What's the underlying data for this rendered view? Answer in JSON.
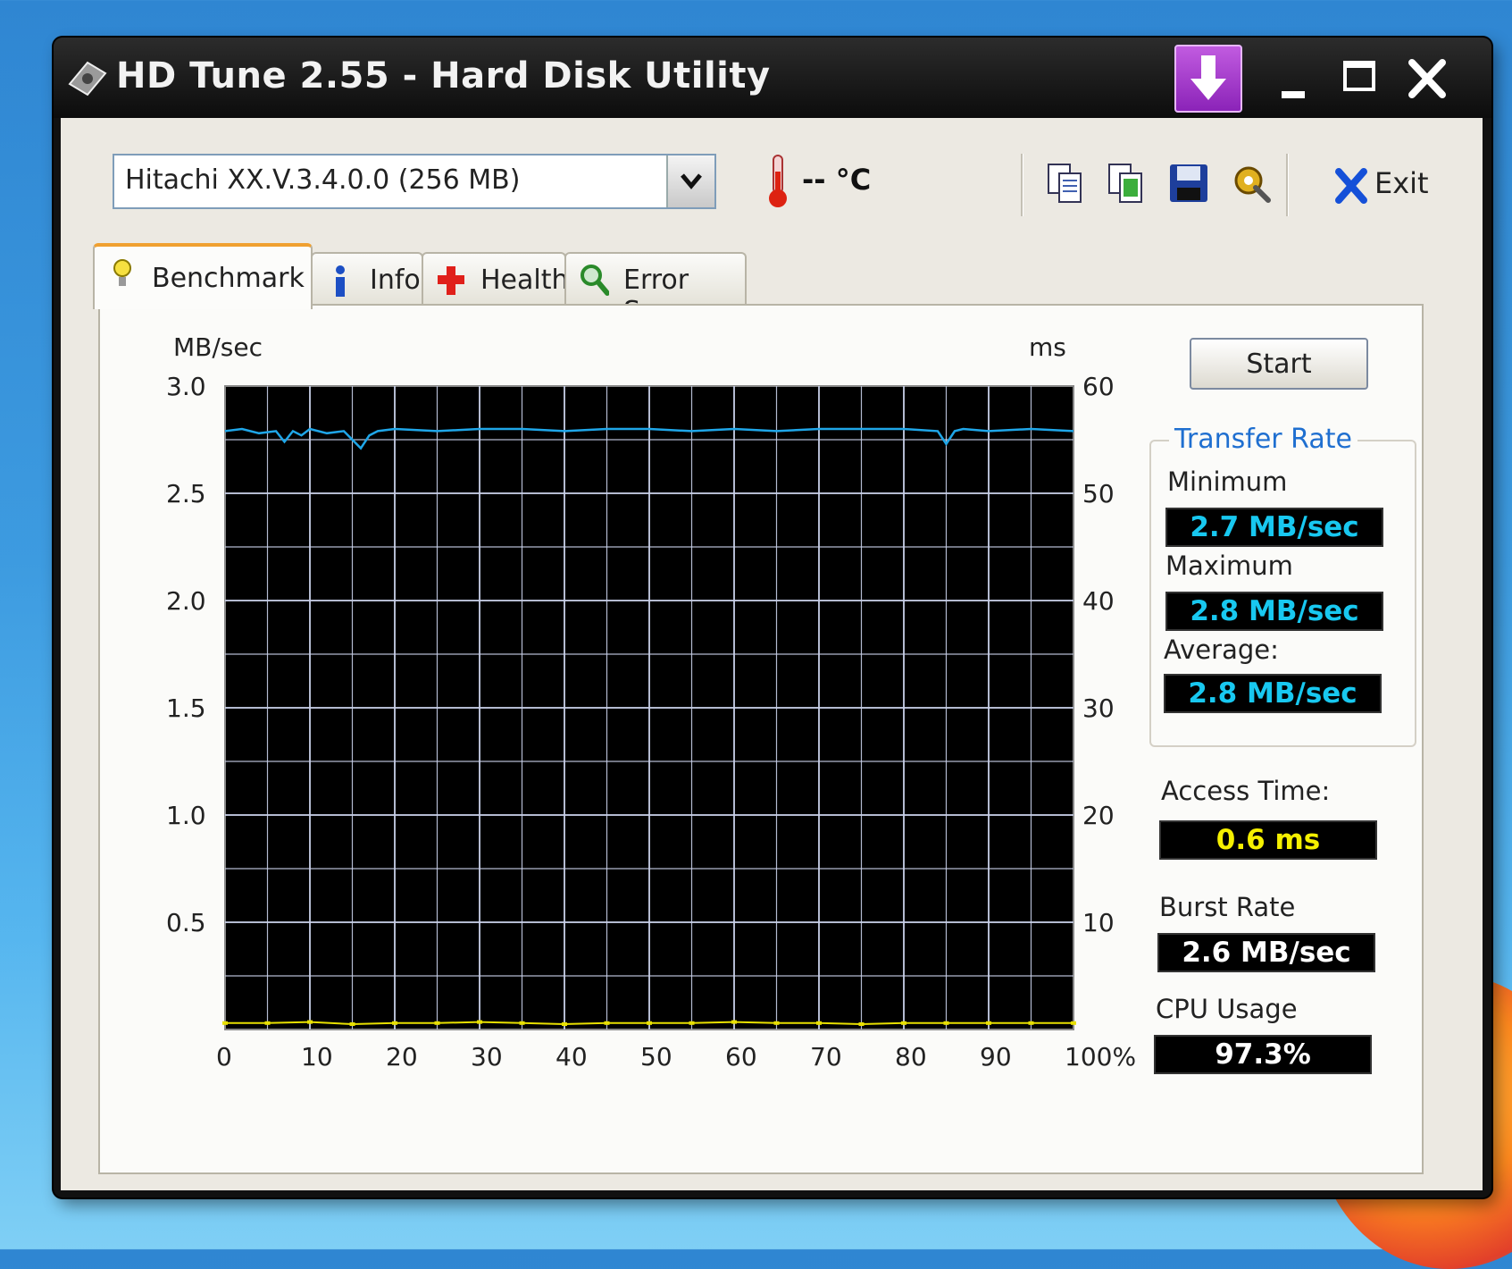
{
  "window": {
    "title": "HD Tune 2.55 - Hard Disk Utility"
  },
  "toolbar": {
    "drive_select_value": "Hitachi XX.V.3.4.0.0 (256 MB)",
    "temperature": "-- °C",
    "exit_label": "Exit",
    "icons": [
      "copy-text-icon",
      "copy-screenshot-icon",
      "save-icon",
      "options-icon"
    ]
  },
  "tabs": [
    {
      "label": "Benchmark",
      "icon": "bulb-icon",
      "active": true
    },
    {
      "label": "Info",
      "icon": "info-icon",
      "active": false
    },
    {
      "label": "Health",
      "icon": "health-cross-icon",
      "active": false
    },
    {
      "label": "Error Scan",
      "icon": "magnifier-icon",
      "active": false
    }
  ],
  "benchmark": {
    "start_label": "Start",
    "transfer_rate": {
      "title": "Transfer Rate",
      "minimum_label": "Minimum",
      "minimum_value": "2.7 MB/sec",
      "maximum_label": "Maximum",
      "maximum_value": "2.8 MB/sec",
      "average_label": "Average:",
      "average_value": "2.8 MB/sec"
    },
    "access_time_label": "Access Time:",
    "access_time_value": "0.6 ms",
    "burst_rate_label": "Burst Rate",
    "burst_rate_value": "2.6 MB/sec",
    "cpu_usage_label": "CPU Usage",
    "cpu_usage_value": "97.3%"
  },
  "colors": {
    "transfer_line": "#1fa6e8",
    "access_points": "#e8e000",
    "plot_background": "#000000",
    "grid": "#c8d0e8",
    "group_title": "#1f6fd0"
  },
  "chart_data": {
    "type": "line",
    "xlabel": "",
    "ylabel": "MB/sec",
    "y2label": "ms",
    "xlim": [
      0,
      100
    ],
    "ylim": [
      0,
      3.0
    ],
    "y2lim": [
      0,
      60
    ],
    "grid": true,
    "x_ticks": [
      "0",
      "10",
      "20",
      "30",
      "40",
      "50",
      "60",
      "70",
      "80",
      "90",
      "100%"
    ],
    "y_ticks": [
      "0.5",
      "1.0",
      "1.5",
      "2.0",
      "2.5",
      "3.0"
    ],
    "y2_ticks": [
      "10",
      "20",
      "30",
      "40",
      "50",
      "60"
    ],
    "series": [
      {
        "axis": "left",
        "x": [
          0,
          2,
          4,
          6,
          7,
          8,
          9,
          10,
          12,
          14,
          15,
          16,
          17,
          18,
          20,
          25,
          30,
          35,
          40,
          45,
          50,
          55,
          60,
          65,
          70,
          75,
          80,
          84,
          85,
          86,
          87,
          90,
          95,
          100
        ],
        "y": [
          2.79,
          2.8,
          2.78,
          2.79,
          2.74,
          2.79,
          2.77,
          2.8,
          2.78,
          2.79,
          2.75,
          2.71,
          2.77,
          2.79,
          2.8,
          2.79,
          2.8,
          2.8,
          2.79,
          2.8,
          2.8,
          2.79,
          2.8,
          2.79,
          2.8,
          2.8,
          2.8,
          2.79,
          2.73,
          2.79,
          2.8,
          2.79,
          2.8,
          2.79
        ]
      },
      {
        "axis": "right",
        "x": [
          0,
          5,
          10,
          15,
          20,
          25,
          30,
          35,
          40,
          45,
          50,
          55,
          60,
          65,
          70,
          75,
          80,
          85,
          90,
          95,
          100
        ],
        "y": [
          0.6,
          0.6,
          0.7,
          0.5,
          0.6,
          0.6,
          0.7,
          0.6,
          0.5,
          0.6,
          0.6,
          0.6,
          0.7,
          0.6,
          0.6,
          0.5,
          0.6,
          0.6,
          0.6,
          0.6,
          0.6
        ]
      }
    ]
  }
}
